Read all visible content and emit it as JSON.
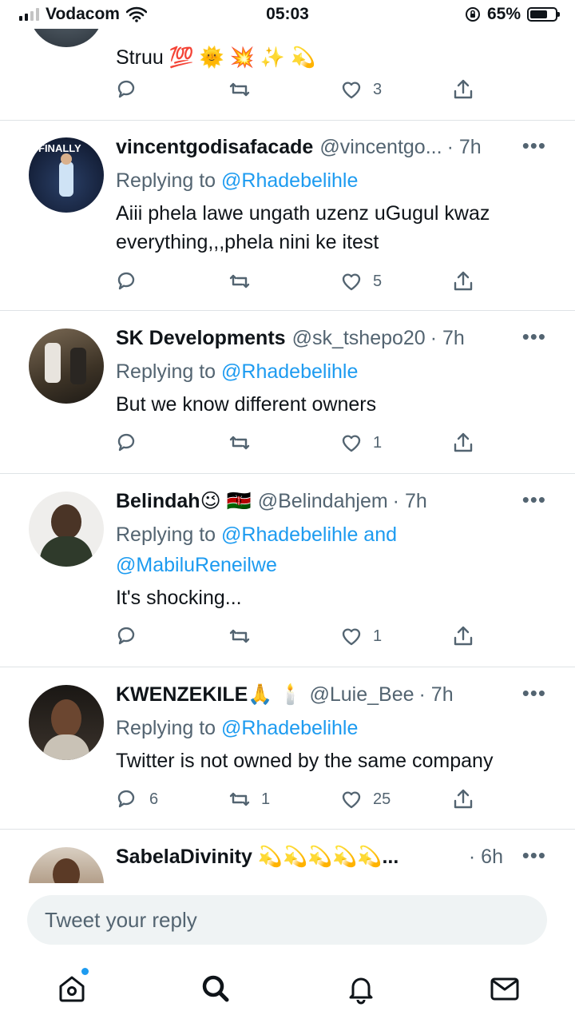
{
  "status_bar": {
    "carrier": "Vodacom",
    "time": "05:03",
    "battery": "65%"
  },
  "tweets": [
    {
      "name": "",
      "handle": "",
      "time": "",
      "text": "Struu 💯 🌞 💥 ✨ 💫",
      "replies": "",
      "retweets": "",
      "likes": "3"
    },
    {
      "name": "vincentgodisafacade",
      "handle": "@vincentgo...",
      "time": "· 7h",
      "replying_prefix": "Replying to",
      "replying_to": "@Rhadebelihle",
      "text": "Aiii phela lawe ungath uzenz uGugul kwaz everything,,,phela nini ke itest",
      "replies": "",
      "retweets": "",
      "likes": "5",
      "avatar_text": "FINALLY"
    },
    {
      "name": "SK Developments",
      "handle": "@sk_tshepo20",
      "time": "· 7h",
      "replying_prefix": "Replying to",
      "replying_to": "@Rhadebelihle",
      "text": "But we know different owners",
      "replies": "",
      "retweets": "",
      "likes": "1"
    },
    {
      "name": "Belindah😉 🇰🇪",
      "handle": "@Belindahjem",
      "time": "· 7h",
      "replying_prefix": "Replying to",
      "replying_to": "@Rhadebelihle and",
      "replying_to_2": "@MabiluReneilwe",
      "text": "It's shocking...",
      "replies": "",
      "retweets": "",
      "likes": "1"
    },
    {
      "name": "KWENZEKILE🙏 🕯️",
      "handle": "@Luie_Bee",
      "time": "· 7h",
      "replying_prefix": "Replying to",
      "replying_to": "@Rhadebelihle",
      "text": "Twitter is not owned by the same company",
      "replies": "6",
      "retweets": "1",
      "likes": "25"
    },
    {
      "name": "SabelaDivinity 💫💫💫💫💫...",
      "handle": "",
      "time": "· 6h"
    }
  ],
  "reply_box": {
    "placeholder": "Tweet your reply"
  },
  "icons": {
    "more": "more-icon",
    "reply": "reply-icon",
    "retweet": "retweet-icon",
    "like": "heart-icon",
    "share": "share-icon",
    "home": "home-icon",
    "search": "search-icon",
    "notifications": "bell-icon",
    "messages": "mail-icon"
  },
  "colors": {
    "link": "#1d9bf0",
    "muted": "#536471",
    "divider": "#dfe3e6"
  }
}
